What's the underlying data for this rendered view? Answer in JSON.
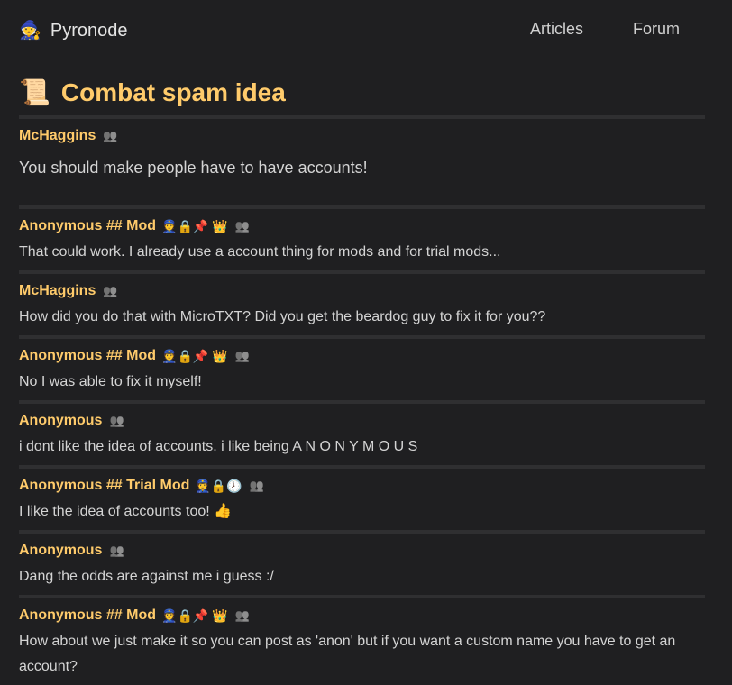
{
  "nav": {
    "brand": "Pyronode",
    "brand_icon": "🧙",
    "links": [
      "Articles",
      "Forum"
    ]
  },
  "thread": {
    "icon": "📜",
    "title": "Combat spam idea"
  },
  "posts": [
    {
      "author": "McHaggins",
      "badges": "",
      "text": "You should make people have to have accounts!"
    },
    {
      "author": "Anonymous ## Mod",
      "badges": "👮🔒📌 👑",
      "text": "That could work. I already use a account thing for mods and for trial mods..."
    },
    {
      "author": "McHaggins",
      "badges": "",
      "text": "How did you do that with MicroTXT? Did you get the beardog guy to fix it for you??"
    },
    {
      "author": "Anonymous ## Mod",
      "badges": "👮🔒📌 👑",
      "text": "No I was able to fix it myself!"
    },
    {
      "author": "Anonymous",
      "badges": "",
      "text": "i dont like the idea of accounts. i like being A N O N Y M O U S"
    },
    {
      "author": "Anonymous ## Trial Mod",
      "badges": "👮🔒🕗",
      "text": "I like the idea of accounts too! 👍"
    },
    {
      "author": "Anonymous",
      "badges": "",
      "text": "Dang the odds are against me i guess :/"
    },
    {
      "author": "Anonymous ## Mod",
      "badges": "👮🔒📌 👑",
      "text": "How about we just make it so you can post as 'anon' but if you want a custom name you have to get an account?"
    }
  ],
  "icons": {
    "anon": "👥"
  }
}
